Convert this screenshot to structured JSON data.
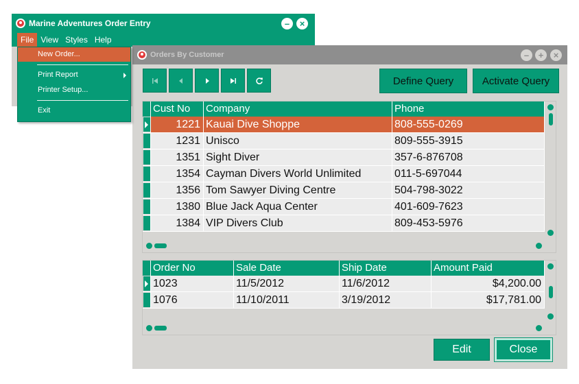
{
  "main_window": {
    "title": "Marine Adventures Order Entry",
    "menu": [
      "File",
      "View",
      "Styles",
      "Help"
    ],
    "file_menu": {
      "items": [
        {
          "label": "New Order...",
          "selected": true
        },
        {
          "label": "Print Report",
          "submenu": true
        },
        {
          "label": "Printer Setup..."
        },
        {
          "label": "Exit"
        }
      ]
    }
  },
  "child_window": {
    "title": "Orders By Customer",
    "buttons": {
      "define_query": "Define Query",
      "activate_query": "Activate Query",
      "edit": "Edit",
      "close": "Close"
    },
    "customers": {
      "columns": [
        "Cust No",
        "Company",
        "Phone"
      ],
      "rows": [
        {
          "cust_no": "1221",
          "company": "Kauai Dive Shoppe",
          "phone": "808-555-0269",
          "selected": true
        },
        {
          "cust_no": "1231",
          "company": "Unisco",
          "phone": "809-555-3915"
        },
        {
          "cust_no": "1351",
          "company": "Sight Diver",
          "phone": "357-6-876708"
        },
        {
          "cust_no": "1354",
          "company": "Cayman Divers World Unlimited",
          "phone": "011-5-697044"
        },
        {
          "cust_no": "1356",
          "company": "Tom Sawyer Diving Centre",
          "phone": "504-798-3022"
        },
        {
          "cust_no": "1380",
          "company": "Blue Jack Aqua Center",
          "phone": "401-609-7623"
        },
        {
          "cust_no": "1384",
          "company": "VIP Divers Club",
          "phone": "809-453-5976"
        }
      ]
    },
    "orders": {
      "columns": [
        "Order No",
        "Sale Date",
        "Ship Date",
        "Amount Paid"
      ],
      "rows": [
        {
          "order_no": "1023",
          "sale_date": "11/5/2012",
          "ship_date": "11/6/2012",
          "amount": "$4,200.00",
          "current": true
        },
        {
          "order_no": "1076",
          "sale_date": "11/10/2011",
          "ship_date": "3/19/2012",
          "amount": "$17,781.00"
        }
      ]
    }
  },
  "colors": {
    "accent": "#069b76",
    "selection": "#d4633a",
    "inactive_title": "#8e8e8e"
  },
  "icons": [
    "app-icon",
    "minimize-icon",
    "close-icon",
    "maximize-icon",
    "first-record-icon",
    "prior-record-icon",
    "next-record-icon",
    "last-record-icon",
    "refresh-icon",
    "submenu-arrow-icon"
  ]
}
